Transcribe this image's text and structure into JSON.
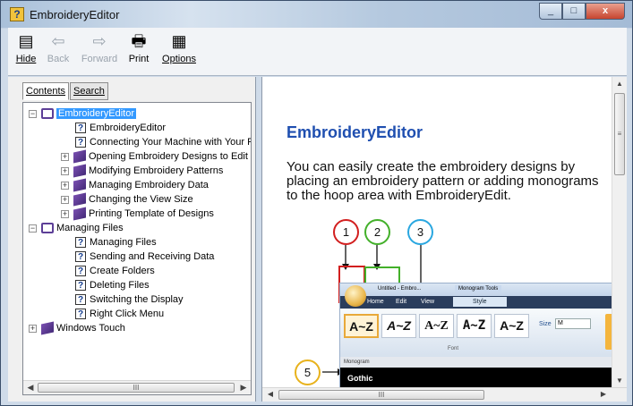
{
  "window": {
    "title": "EmbroideryEditor"
  },
  "window_buttons": {
    "minimize": "_",
    "maximize": "□",
    "close": "x"
  },
  "toolbar": {
    "items": [
      {
        "label": "Hide",
        "icon": "hide-icon",
        "enabled": true
      },
      {
        "label": "Back",
        "icon": "back-arrow-icon",
        "enabled": false
      },
      {
        "label": "Forward",
        "icon": "forward-arrow-icon",
        "enabled": false
      },
      {
        "label": "Print",
        "icon": "print-icon",
        "enabled": true
      },
      {
        "label": "Options",
        "icon": "options-icon",
        "enabled": true
      }
    ]
  },
  "nav": {
    "tabs": [
      {
        "label": "Contents",
        "active": true
      },
      {
        "label": "Search",
        "active": false
      }
    ],
    "tree": [
      {
        "label": "EmbroideryEditor",
        "type": "book-open",
        "expander": "−",
        "selected": true
      },
      {
        "label": "EmbroideryEditor",
        "type": "page"
      },
      {
        "label": "Connecting Your Machine with Your P",
        "type": "page"
      },
      {
        "label": "Opening Embroidery Designs to Edit",
        "type": "book",
        "expander": "+"
      },
      {
        "label": "Modifying Embroidery Patterns",
        "type": "book",
        "expander": "+"
      },
      {
        "label": "Managing Embroidery Data",
        "type": "book",
        "expander": "+"
      },
      {
        "label": "Changing the View Size",
        "type": "book",
        "expander": "+"
      },
      {
        "label": "Printing Template of Designs",
        "type": "book",
        "expander": "+"
      },
      {
        "label": "Managing Files",
        "type": "book-open",
        "expander": "−"
      },
      {
        "label": "Managing Files",
        "type": "page"
      },
      {
        "label": "Sending and Receiving Data",
        "type": "page"
      },
      {
        "label": "Create Folders",
        "type": "page"
      },
      {
        "label": "Deleting Files",
        "type": "page"
      },
      {
        "label": "Switching the Display",
        "type": "page"
      },
      {
        "label": "Right Click Menu",
        "type": "page"
      },
      {
        "label": "Windows Touch",
        "type": "book",
        "expander": "+"
      }
    ],
    "scroll_thumb_label": "III"
  },
  "content": {
    "heading": "EmbroideryEditor",
    "paragraph": "You can easily create the embroidery designs by placing an embroidery pattern or adding monograms to the hoop area with EmbroideryEdit.",
    "callouts": [
      {
        "number": "1",
        "color": "#d21f1f"
      },
      {
        "number": "2",
        "color": "#43b02a"
      },
      {
        "number": "3",
        "color": "#2aa7e0"
      },
      {
        "number": "5",
        "color": "#e8b21c"
      }
    ],
    "screenshot": {
      "qat_title": "Untitled - Embro...",
      "context_tab": "Monogram Tools",
      "tabs": [
        "Home",
        "Edit",
        "View",
        "Style"
      ],
      "font_buttons": [
        "A~Z",
        "A~Z",
        "A~Z",
        "A~Z",
        "A~Z"
      ],
      "size_label": "Size",
      "size_value": "M",
      "group_label": "Font",
      "monogram_label": "Monogram",
      "font_name": "Gothic"
    },
    "scroll_thumb_label": "III"
  }
}
